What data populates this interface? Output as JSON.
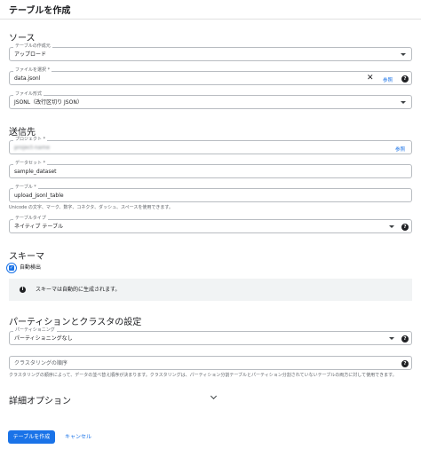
{
  "dialog": {
    "title": "テーブルを作成"
  },
  "source": {
    "heading": "ソース",
    "create_from": {
      "label": "テーブルの作成元",
      "value": "アップロード"
    },
    "select_file": {
      "label": "ファイルを選択 *",
      "value": "data.jsonl",
      "browse": "参照"
    },
    "file_format": {
      "label": "ファイル形式",
      "value": "JSONL（改行区切り JSON）"
    }
  },
  "destination": {
    "heading": "送信先",
    "project": {
      "label": "プロジェクト *",
      "value": "project-name",
      "browse": "参照"
    },
    "dataset": {
      "label": "データセット *",
      "value": "sample_dataset"
    },
    "table": {
      "label": "テーブル *",
      "value": "upload_jsonl_table",
      "hint": "Unicode の文字、マーク、数字、コネクタ、ダッシュ、スペースを使用できます。"
    },
    "table_type": {
      "label": "テーブルタイプ",
      "value": "ネイティブ テーブル"
    }
  },
  "schema": {
    "heading": "スキーマ",
    "auto_detect": {
      "label": "自動検出",
      "checked": true
    },
    "info": "スキーマは自動的に生成されます。"
  },
  "partition": {
    "heading": "パーティションとクラスタの設定",
    "partitioning": {
      "label": "パーティショニング",
      "value": "パーティショニングなし"
    },
    "clustering": {
      "placeholder": "クラスタリングの順序",
      "hint": "クラスタリングの順序によって、データの並べ替え順序が決まります。クラスタリングは、パーティション分割テーブルとパーティション分割されていないテーブルの両方に対して使用できます。"
    }
  },
  "advanced": {
    "heading": "詳細オプション"
  },
  "actions": {
    "create": "テーブルを作成",
    "cancel": "キャンセル"
  },
  "colors": {
    "accent": "#1a73e8",
    "info_bg": "#f1f3f4"
  }
}
